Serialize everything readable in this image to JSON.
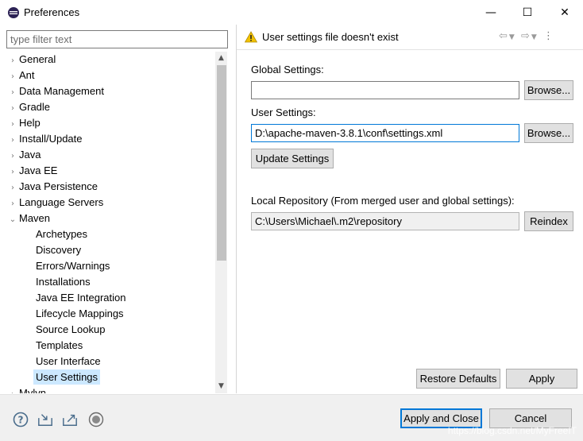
{
  "window": {
    "title": "Preferences",
    "controls": {
      "minimize": "—",
      "maximize": "☐",
      "close": "✕"
    }
  },
  "sidebar": {
    "filter_placeholder": "type filter text",
    "items": [
      {
        "label": "General",
        "expandable": true,
        "level": 0
      },
      {
        "label": "Ant",
        "expandable": true,
        "level": 0
      },
      {
        "label": "Data Management",
        "expandable": true,
        "level": 0
      },
      {
        "label": "Gradle",
        "expandable": true,
        "level": 0
      },
      {
        "label": "Help",
        "expandable": true,
        "level": 0
      },
      {
        "label": "Install/Update",
        "expandable": true,
        "level": 0
      },
      {
        "label": "Java",
        "expandable": true,
        "level": 0
      },
      {
        "label": "Java EE",
        "expandable": true,
        "level": 0
      },
      {
        "label": "Java Persistence",
        "expandable": true,
        "level": 0
      },
      {
        "label": "Language Servers",
        "expandable": true,
        "level": 0
      },
      {
        "label": "Maven",
        "expandable": true,
        "expanded": true,
        "level": 0
      },
      {
        "label": "Archetypes",
        "level": 1
      },
      {
        "label": "Discovery",
        "level": 1
      },
      {
        "label": "Errors/Warnings",
        "level": 1
      },
      {
        "label": "Installations",
        "level": 1
      },
      {
        "label": "Java EE Integration",
        "level": 1
      },
      {
        "label": "Lifecycle Mappings",
        "level": 1
      },
      {
        "label": "Source Lookup",
        "level": 1
      },
      {
        "label": "Templates",
        "level": 1
      },
      {
        "label": "User Interface",
        "level": 1
      },
      {
        "label": "User Settings",
        "level": 1,
        "selected": true
      },
      {
        "label": "Mylyn",
        "expandable": true,
        "level": 0
      }
    ]
  },
  "page": {
    "title": "User settings file doesn't exist",
    "global_settings_label": "Global Settings:",
    "global_settings_value": "",
    "browse_label": "Browse...",
    "user_settings_label": "User Settings:",
    "user_settings_value": "D:\\apache-maven-3.8.1\\conf\\settings.xml",
    "update_settings_label": "Update Settings",
    "local_repo_label": "Local Repository (From merged user and global settings):",
    "local_repo_value": "C:\\Users\\Michael\\.m2\\repository",
    "reindex_label": "Reindex",
    "restore_defaults_label": "Restore Defaults",
    "apply_label": "Apply"
  },
  "footer": {
    "apply_close_label": "Apply and Close",
    "cancel_label": "Cancel",
    "watermark": "https://blog.csdn.net/MyFreeIT"
  },
  "colors": {
    "accent": "#0078d7",
    "selection": "#cce8ff",
    "warning": "#f2c200"
  }
}
